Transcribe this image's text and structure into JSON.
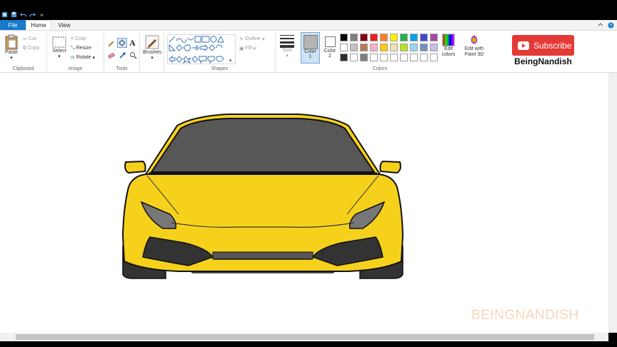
{
  "menubar": {
    "file_label": "File",
    "tabs": [
      "Home",
      "View"
    ]
  },
  "clipboard": {
    "paste_label": "Paste",
    "cut_label": "Cut",
    "copy_label": "Copy",
    "group_label": "Clipboard"
  },
  "image": {
    "select_label": "Select",
    "crop_label": "Crop",
    "resize_label": "Resize",
    "rotate_label": "Rotate",
    "group_label": "Image"
  },
  "tools": {
    "group_label": "Tools",
    "brushes_label": "Brushes"
  },
  "shapes": {
    "outline_label": "Outline",
    "fill_label": "Fill",
    "group_label": "Shapes"
  },
  "colors": {
    "size_label": "Size",
    "color1_label": "Color",
    "color1_num": "1",
    "color2_label": "Color",
    "color2_num": "2",
    "edit_colors_label": "Edit colors",
    "edit_paint3d_label": "Edit with Paint 3D",
    "group_label": "Colors",
    "palette": [
      [
        "#000000",
        "#7f7f7f",
        "#880015",
        "#ed1c24",
        "#ff7f27",
        "#fff200",
        "#22b14c",
        "#00a2e8",
        "#3f48cc",
        "#a349a4"
      ],
      [
        "#ffffff",
        "#c3c3c3",
        "#b97a57",
        "#ffaec9",
        "#ffc90e",
        "#efe4b0",
        "#b5e61d",
        "#99d9ea",
        "#7092be",
        "#c8bfe7"
      ],
      [
        "#2b2b2b",
        "#ffffff",
        "#7f7f7f",
        "#ffffff",
        "#ffffff",
        "#ffffff",
        "#ffffff",
        "#ffffff",
        "#ffffff",
        "#ffffff"
      ]
    ],
    "color1_value": "#b4b4b4",
    "color2_value": "#ffffff"
  },
  "overlay": {
    "subscribe_label": "Subscribe",
    "channel_name": "BeingNandish",
    "watermark": "BEINGNANDISH"
  },
  "drawing": {
    "body_color": "#f6d11c",
    "windshield_color": "#575757",
    "dark_color": "#333333"
  }
}
